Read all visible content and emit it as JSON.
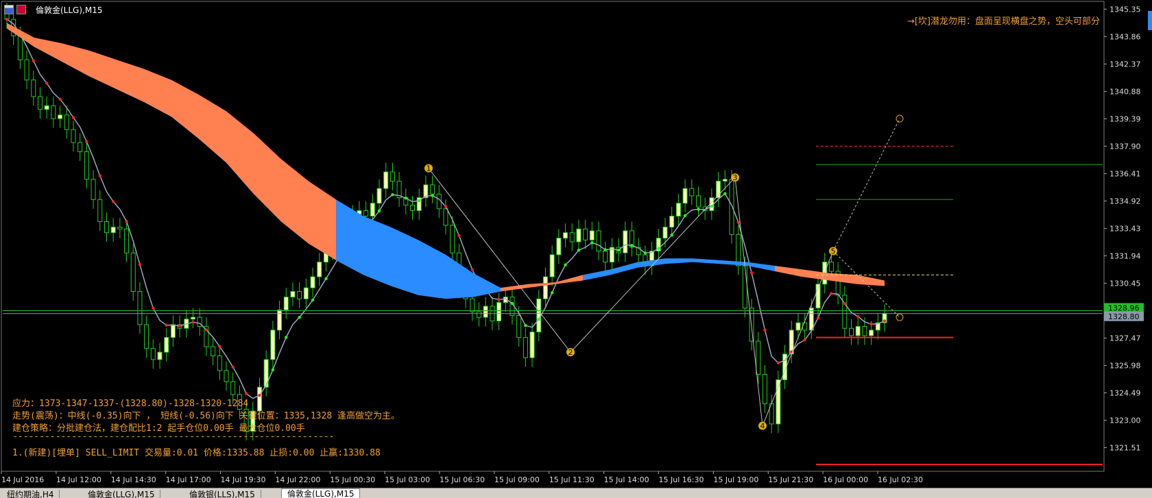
{
  "window": {
    "title": "倫敦金(LLG),M15"
  },
  "signal": "→[坎]潜龙勿用：盘面呈现横盘之势，空头可部分",
  "info_lines": [
    "应力：1373-1347-1337-(1328.80)-1328-1320-1284",
    "走势(震荡)：中线(-0.35)向下 ， 短线(-0.56)向下 关键位置：1335,1328 逢高做空为主。",
    "建仓策略：分批建仓法，建仓配比1:2  起手仓位0.00手 最大仓位0.00手",
    "------------------------------------------------------------",
    "1.(新建)[埋单] SELL_LIMIT 交易量:0.01 价格:1335.88 止损:0.00 止赢:1330.88"
  ],
  "tabs": [
    {
      "label": "纽约期油,H4"
    },
    {
      "label": "倫敦金(LLG),M15"
    },
    {
      "label": "倫敦银(LLS),M15"
    },
    {
      "label": "倫敦金(LLG),M15",
      "active": true
    }
  ],
  "chart_data": {
    "type": "candlestick",
    "ylim": [
      1320.3,
      1345.7
    ],
    "y_ticks": [
      "1345.35",
      "1343.86",
      "1342.37",
      "1340.88",
      "1339.39",
      "1337.90",
      "1336.41",
      "1334.92",
      "1333.43",
      "1331.94",
      "1330.45",
      "1328.96",
      "1327.47",
      "1325.98",
      "1324.49",
      "1323.00",
      "1321.51"
    ],
    "x_ticks": [
      "14 Jul 2016",
      "14 Jul 12:00",
      "14 Jul 14:30",
      "14 Jul 17:00",
      "14 Jul 19:30",
      "14 Jul 22:00",
      "15 Jul 00:30",
      "15 Jul 03:00",
      "15 Jul 06:30",
      "15 Jul 09:00",
      "15 Jul 11:30",
      "15 Jul 14:00",
      "15 Jul 16:30",
      "15 Jul 19:00",
      "15 Jul 21:30",
      "16 Jul 00:00",
      "16 Jul 02:30"
    ],
    "current_price": "1328.80",
    "price_labels": [
      "1328.96",
      "1328.80"
    ],
    "closes": [
      1344.8,
      1343.9,
      1342.6,
      1341.5,
      1340.6,
      1339.9,
      1340.1,
      1339.4,
      1339.6,
      1338.8,
      1338.1,
      1337.6,
      1336.1,
      1335.0,
      1333.8,
      1333.2,
      1333.5,
      1333.4,
      1332.1,
      1330.0,
      1328.2,
      1326.9,
      1326.3,
      1326.7,
      1327.5,
      1328.2,
      1328.0,
      1328.5,
      1328.6,
      1328.1,
      1327.0,
      1326.5,
      1325.7,
      1325.1,
      1324.4,
      1323.6,
      1322.4,
      1323.5,
      1324.8,
      1326.3,
      1327.9,
      1329.0,
      1329.7,
      1330.0,
      1329.6,
      1330.2,
      1330.8,
      1331.6,
      1332.2,
      1332.8,
      1333.5,
      1333.9,
      1334.2,
      1334.4,
      1334.1,
      1334.8,
      1335.6,
      1336.5,
      1336.0,
      1335.1,
      1334.7,
      1334.4,
      1335.1,
      1335.8,
      1335.3,
      1334.5,
      1333.6,
      1332.1,
      1330.8,
      1329.6,
      1328.9,
      1328.6,
      1329.2,
      1328.4,
      1329.4,
      1329.7,
      1328.7,
      1327.5,
      1326.4,
      1327.8,
      1329.6,
      1330.8,
      1332.0,
      1332.9,
      1333.2,
      1332.7,
      1333.4,
      1332.8,
      1333.3,
      1332.2,
      1331.6,
      1332.4,
      1332.1,
      1333.3,
      1332.4,
      1332.0,
      1331.4,
      1332.2,
      1332.9,
      1333.5,
      1334.1,
      1334.8,
      1335.6,
      1335.2,
      1334.6,
      1334.4,
      1335.1,
      1336.0,
      1336.1,
      1333.1,
      1331.4,
      1329.1,
      1327.3,
      1325.5,
      1323.9,
      1322.8,
      1325.2,
      1326.6,
      1327.9,
      1328.3,
      1327.9,
      1329.1,
      1330.4,
      1331.6,
      1331.1,
      1329.8,
      1328.0,
      1327.6,
      1328.1,
      1327.6,
      1327.9,
      1328.3,
      1328.8
    ],
    "ribbon_upper": [
      1344.6,
      1343.8,
      1343.5,
      1343.1,
      1342.6,
      1342.1,
      1341.5,
      1340.7,
      1339.8,
      1338.6,
      1337.2,
      1336.0,
      1335.0,
      1334.1,
      1333.5,
      1332.8,
      1332.0,
      1331.0,
      1330.2,
      1330.4,
      1330.5,
      1330.9,
      1331.2,
      1331.6,
      1331.8,
      1331.8,
      1331.7,
      1331.6,
      1331.4,
      1331.2,
      1331.0,
      1330.9,
      1330.6
    ],
    "ribbon_lower": [
      1344.3,
      1343.3,
      1342.5,
      1341.7,
      1341.0,
      1340.3,
      1339.5,
      1338.3,
      1337.0,
      1335.3,
      1333.8,
      1332.6,
      1331.7,
      1330.9,
      1330.3,
      1329.8,
      1329.6,
      1329.7,
      1330.0,
      1330.2,
      1330.4,
      1330.6,
      1330.9,
      1331.3,
      1331.5,
      1331.6,
      1331.5,
      1331.4,
      1331.1,
      1330.8,
      1330.6,
      1330.4,
      1330.3
    ],
    "zigzag": [
      {
        "label": "1",
        "value": 1336.7
      },
      {
        "label": "2",
        "value": 1326.7
      },
      {
        "label": "3",
        "value": 1336.2
      },
      {
        "label": "4",
        "value": 1322.7
      },
      {
        "label": "5",
        "value": 1332.2
      }
    ],
    "levels": [
      {
        "value": 1337.9,
        "color": "#ff3030",
        "style": "dashed"
      },
      {
        "value": 1336.9,
        "color": "#20a020",
        "style": "solid"
      },
      {
        "value": 1335.0,
        "color": "#20a020",
        "style": "solid"
      },
      {
        "value": 1330.9,
        "color": "#e0e060",
        "style": "dashed"
      },
      {
        "value": 1327.5,
        "color": "#ff2020",
        "style": "solid"
      },
      {
        "value": 1320.6,
        "color": "#ff2020",
        "style": "solid"
      }
    ],
    "colors": {
      "background": "#000000",
      "bull": "#ffffb0",
      "bear": "#20d020",
      "ribbon_bear": "#ff8050",
      "ribbon_bull": "#2a8cff",
      "ma": "#9aa8c0",
      "zigzag": "#c0c0c0",
      "marker": "#e0b000"
    }
  }
}
